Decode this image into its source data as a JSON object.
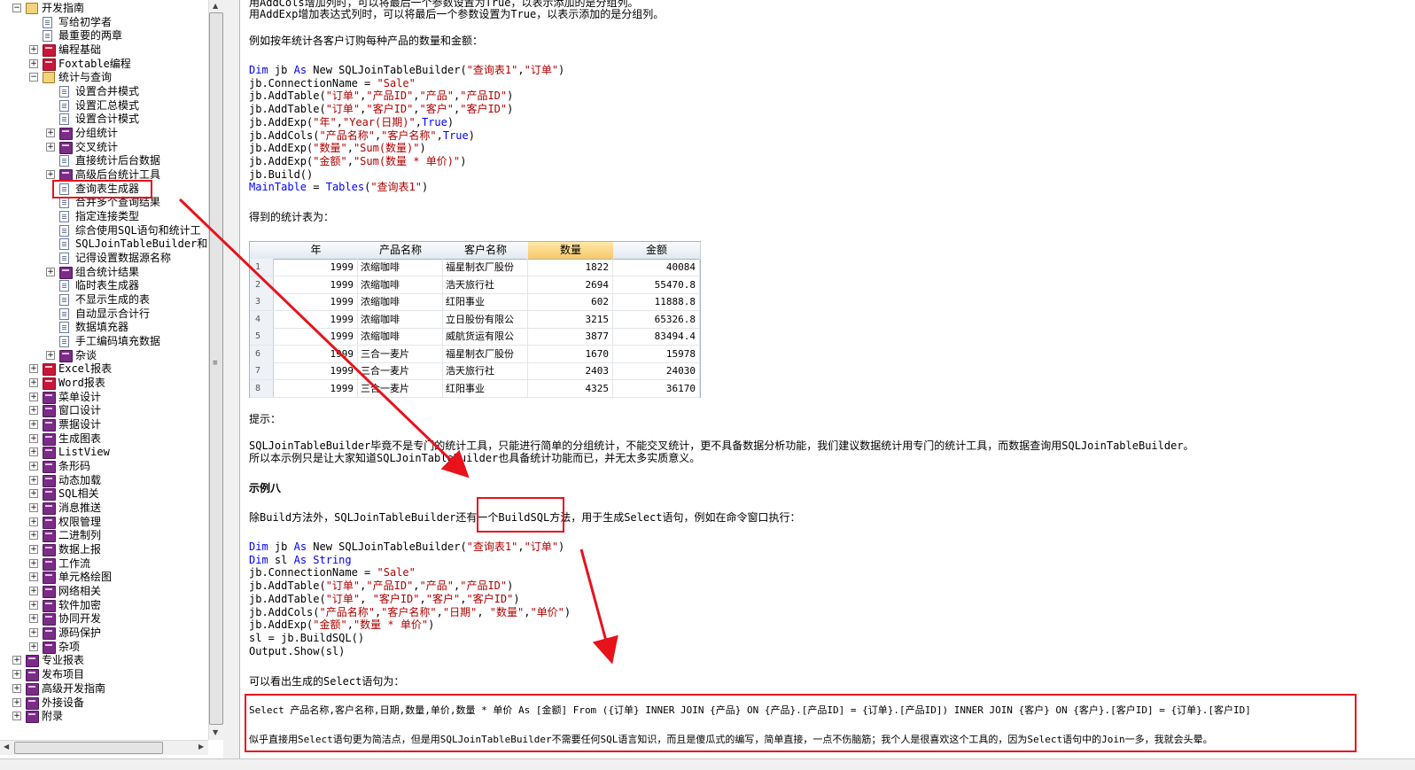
{
  "tree": {
    "items": [
      {
        "label": "开发指南",
        "level": 0,
        "icon": "book-open-icon",
        "expander": "minus"
      },
      {
        "label": "写给初学者",
        "level": 1,
        "icon": "page-icon",
        "expander": ""
      },
      {
        "label": "最重要的两章",
        "level": 1,
        "icon": "page-icon",
        "expander": ""
      },
      {
        "label": "编程基础",
        "level": 1,
        "icon": "book-red-icon",
        "expander": "plus"
      },
      {
        "label": "Foxtable编程",
        "level": 1,
        "icon": "book-red-icon",
        "expander": "plus"
      },
      {
        "label": "统计与查询",
        "level": 1,
        "icon": "book-open-icon",
        "expander": "minus"
      },
      {
        "label": "设置合并模式",
        "level": 2,
        "icon": "page-icon",
        "expander": ""
      },
      {
        "label": "设置汇总模式",
        "level": 2,
        "icon": "page-icon",
        "expander": ""
      },
      {
        "label": "设置合计模式",
        "level": 2,
        "icon": "page-icon",
        "expander": ""
      },
      {
        "label": "分组统计",
        "level": 2,
        "icon": "book-closed-icon",
        "expander": "plus"
      },
      {
        "label": "交叉统计",
        "level": 2,
        "icon": "book-closed-icon",
        "expander": "plus"
      },
      {
        "label": "直接统计后台数据",
        "level": 2,
        "icon": "page-icon",
        "expander": ""
      },
      {
        "label": "高级后台统计工具",
        "level": 2,
        "icon": "book-closed-icon",
        "expander": "plus"
      },
      {
        "label": "查询表生成器",
        "level": 2,
        "icon": "page-icon",
        "expander": "",
        "selected": true
      },
      {
        "label": "合并多个查询结果",
        "level": 2,
        "icon": "page-icon",
        "expander": ""
      },
      {
        "label": "指定连接类型",
        "level": 2,
        "icon": "page-icon",
        "expander": ""
      },
      {
        "label": "综合使用SQL语句和统计工",
        "level": 2,
        "icon": "page-icon",
        "expander": ""
      },
      {
        "label": "SQLJoinTableBuilder和纟",
        "level": 2,
        "icon": "page-icon",
        "expander": ""
      },
      {
        "label": "记得设置数据源名称",
        "level": 2,
        "icon": "page-icon",
        "expander": ""
      },
      {
        "label": "组合统计结果",
        "level": 2,
        "icon": "book-closed-icon",
        "expander": "plus"
      },
      {
        "label": "临时表生成器",
        "level": 2,
        "icon": "page-icon",
        "expander": ""
      },
      {
        "label": "不显示生成的表",
        "level": 2,
        "icon": "page-icon",
        "expander": ""
      },
      {
        "label": "自动显示合计行",
        "level": 2,
        "icon": "page-icon",
        "expander": ""
      },
      {
        "label": "数据填充器",
        "level": 2,
        "icon": "page-icon",
        "expander": ""
      },
      {
        "label": "手工编码填充数据",
        "level": 2,
        "icon": "page-icon",
        "expander": ""
      },
      {
        "label": "杂谈",
        "level": 2,
        "icon": "book-closed-icon",
        "expander": "plus"
      },
      {
        "label": "Excel报表",
        "level": 1,
        "icon": "book-red-icon",
        "expander": "plus"
      },
      {
        "label": "Word报表",
        "level": 1,
        "icon": "book-red-icon",
        "expander": "plus"
      },
      {
        "label": "菜单设计",
        "level": 1,
        "icon": "book-closed-icon",
        "expander": "plus"
      },
      {
        "label": "窗口设计",
        "level": 1,
        "icon": "book-closed-icon",
        "expander": "plus"
      },
      {
        "label": "票据设计",
        "level": 1,
        "icon": "book-closed-icon",
        "expander": "plus"
      },
      {
        "label": "生成图表",
        "level": 1,
        "icon": "book-closed-icon",
        "expander": "plus"
      },
      {
        "label": "ListView",
        "level": 1,
        "icon": "book-closed-icon",
        "expander": "plus"
      },
      {
        "label": "条形码",
        "level": 1,
        "icon": "book-closed-icon",
        "expander": "plus"
      },
      {
        "label": "动态加载",
        "level": 1,
        "icon": "book-closed-icon",
        "expander": "plus"
      },
      {
        "label": "SQL相关",
        "level": 1,
        "icon": "book-closed-icon",
        "expander": "plus"
      },
      {
        "label": "消息推送",
        "level": 1,
        "icon": "book-closed-icon",
        "expander": "plus"
      },
      {
        "label": "权限管理",
        "level": 1,
        "icon": "book-closed-icon",
        "expander": "plus"
      },
      {
        "label": "二进制列",
        "level": 1,
        "icon": "book-closed-icon",
        "expander": "plus"
      },
      {
        "label": "数据上报",
        "level": 1,
        "icon": "book-closed-icon",
        "expander": "plus"
      },
      {
        "label": "工作流",
        "level": 1,
        "icon": "book-closed-icon",
        "expander": "plus"
      },
      {
        "label": "单元格绘图",
        "level": 1,
        "icon": "book-closed-icon",
        "expander": "plus"
      },
      {
        "label": "网络相关",
        "level": 1,
        "icon": "book-closed-icon",
        "expander": "plus"
      },
      {
        "label": "软件加密",
        "level": 1,
        "icon": "book-closed-icon",
        "expander": "plus"
      },
      {
        "label": "协同开发",
        "level": 1,
        "icon": "book-closed-icon",
        "expander": "plus"
      },
      {
        "label": "源码保护",
        "level": 1,
        "icon": "book-closed-icon",
        "expander": "plus"
      },
      {
        "label": "杂项",
        "level": 1,
        "icon": "book-closed-icon",
        "expander": "plus"
      },
      {
        "label": "专业报表",
        "level": 0,
        "icon": "book-closed-icon",
        "expander": "plus"
      },
      {
        "label": "发布项目",
        "level": 0,
        "icon": "book-closed-icon",
        "expander": "plus"
      },
      {
        "label": "高级开发指南",
        "level": 0,
        "icon": "book-closed-icon",
        "expander": "plus"
      },
      {
        "label": "外接设备",
        "level": 0,
        "icon": "book-closed-icon",
        "expander": "plus"
      },
      {
        "label": "附录",
        "level": 0,
        "icon": "book-closed-icon",
        "expander": "plus"
      }
    ]
  },
  "doc": {
    "intro_line1": "用AddCols增加列时，可以将最后一个参数设置为True，以表示添加的是分组列。",
    "intro_line2": "用AddExp增加表达式列时，可以将最后一个参数设置为True，以表示添加的是分组列。",
    "example_intro": "例如按年统计各客户订购每种产品的数量和金额：",
    "code1": [
      [
        {
          "t": "Dim ",
          "c": "kw"
        },
        {
          "t": "jb ",
          "c": ""
        },
        {
          "t": "As ",
          "c": "kw"
        },
        {
          "t": "New SQLJoinTableBuilder(",
          "c": ""
        },
        {
          "t": "\"查询表1\"",
          "c": "st"
        },
        {
          "t": ",",
          "c": ""
        },
        {
          "t": "\"订单\"",
          "c": "st"
        },
        {
          "t": ")",
          "c": ""
        }
      ],
      [
        {
          "t": "jb.ConnectionName = ",
          "c": ""
        },
        {
          "t": "\"Sale\"",
          "c": "st"
        }
      ],
      [
        {
          "t": "jb.AddTable(",
          "c": ""
        },
        {
          "t": "\"订单\"",
          "c": "st"
        },
        {
          "t": ",",
          "c": ""
        },
        {
          "t": "\"产品ID\"",
          "c": "st"
        },
        {
          "t": ",",
          "c": ""
        },
        {
          "t": "\"产品\"",
          "c": "st"
        },
        {
          "t": ",",
          "c": ""
        },
        {
          "t": "\"产品ID\"",
          "c": "st"
        },
        {
          "t": ")",
          "c": ""
        }
      ],
      [
        {
          "t": "jb.AddTable(",
          "c": ""
        },
        {
          "t": "\"订单\"",
          "c": "st"
        },
        {
          "t": ",",
          "c": ""
        },
        {
          "t": "\"客户ID\"",
          "c": "st"
        },
        {
          "t": ",",
          "c": ""
        },
        {
          "t": "\"客户\"",
          "c": "st"
        },
        {
          "t": ",",
          "c": ""
        },
        {
          "t": "\"客户ID\"",
          "c": "st"
        },
        {
          "t": ")",
          "c": ""
        }
      ],
      [
        {
          "t": "jb.AddExp(",
          "c": ""
        },
        {
          "t": "\"年\"",
          "c": "st"
        },
        {
          "t": ",",
          "c": ""
        },
        {
          "t": "\"Year(日期)\"",
          "c": "st"
        },
        {
          "t": ",",
          "c": ""
        },
        {
          "t": "True",
          "c": "kw"
        },
        {
          "t": ")",
          "c": ""
        }
      ],
      [
        {
          "t": "jb.AddCols(",
          "c": ""
        },
        {
          "t": "\"产品名称\"",
          "c": "st"
        },
        {
          "t": ",",
          "c": ""
        },
        {
          "t": "\"客户名称\"",
          "c": "st"
        },
        {
          "t": ",",
          "c": ""
        },
        {
          "t": "True",
          "c": "kw"
        },
        {
          "t": ")",
          "c": ""
        }
      ],
      [
        {
          "t": "jb.AddExp(",
          "c": ""
        },
        {
          "t": "\"数量\"",
          "c": "st"
        },
        {
          "t": ",",
          "c": ""
        },
        {
          "t": "\"Sum(数量)\"",
          "c": "st"
        },
        {
          "t": ")",
          "c": ""
        }
      ],
      [
        {
          "t": "jb.AddExp(",
          "c": ""
        },
        {
          "t": "\"金额\"",
          "c": "st"
        },
        {
          "t": ",",
          "c": ""
        },
        {
          "t": "\"Sum(数量 * 单价)\"",
          "c": "st"
        },
        {
          "t": ")",
          "c": ""
        }
      ],
      [
        {
          "t": "jb.Build()",
          "c": ""
        }
      ],
      [
        {
          "t": "MainTable",
          "c": "kw"
        },
        {
          "t": " = ",
          "c": ""
        },
        {
          "t": "Tables",
          "c": "kw"
        },
        {
          "t": "(",
          "c": ""
        },
        {
          "t": "\"查询表1\"",
          "c": "st"
        },
        {
          "t": ")",
          "c": ""
        }
      ]
    ],
    "result_label": "得到的统计表为：",
    "grid": {
      "headers": [
        "年",
        "产品名称",
        "客户名称",
        "数量",
        "金额"
      ],
      "selected_header": 3,
      "rows": [
        [
          "1",
          "1999",
          "浓缩咖啡",
          "福星制衣厂股份",
          "1822",
          "40084"
        ],
        [
          "2",
          "1999",
          "浓缩咖啡",
          "浩天旅行社",
          "2694",
          "55470.8"
        ],
        [
          "3",
          "1999",
          "浓缩咖啡",
          "红阳事业",
          "602",
          "11888.8"
        ],
        [
          "4",
          "1999",
          "浓缩咖啡",
          "立日股份有限公",
          "3215",
          "65326.8"
        ],
        [
          "5",
          "1999",
          "浓缩咖啡",
          "威航货运有限公",
          "3877",
          "83494.4"
        ],
        [
          "6",
          "1999",
          "三合一麦片",
          "福星制衣厂股份",
          "1670",
          "15978"
        ],
        [
          "7",
          "1999",
          "三合一麦片",
          "浩天旅行社",
          "2403",
          "24030"
        ],
        [
          "8",
          "1999",
          "三合一麦片",
          "红阳事业",
          "4325",
          "36170"
        ]
      ]
    },
    "tip_label": "提示：",
    "tip_line1": "SQLJoinTableBuilder毕竟不是专门的统计工具，只能进行简单的分组统计，不能交叉统计，更不具备数据分析功能，我们建议数据统计用专门的统计工具，而数据查询用SQLJoinTableBuilder。",
    "tip_line2": "所以本示例只是让大家知道SQLJoinTableBuilder也具备统计功能而已，并无太多实质意义。",
    "example8_title": "示例八",
    "example8_desc": "除Build方法外，SQLJoinTableBuilder还有一个BuildSQL方法，用于生成Select语句，例如在命令窗口执行：",
    "code2": [
      [
        {
          "t": "Dim ",
          "c": "kw"
        },
        {
          "t": "jb ",
          "c": ""
        },
        {
          "t": "As ",
          "c": "kw"
        },
        {
          "t": "New SQLJoinTableBuilder(",
          "c": ""
        },
        {
          "t": "\"查询表1\"",
          "c": "st"
        },
        {
          "t": ",",
          "c": ""
        },
        {
          "t": "\"订单\"",
          "c": "st"
        },
        {
          "t": ")",
          "c": ""
        }
      ],
      [
        {
          "t": "Dim ",
          "c": "kw"
        },
        {
          "t": "sl ",
          "c": ""
        },
        {
          "t": "As ",
          "c": "kw"
        },
        {
          "t": "String",
          "c": "mt"
        }
      ],
      [
        {
          "t": "jb.ConnectionName = ",
          "c": ""
        },
        {
          "t": "\"Sale\"",
          "c": "st"
        }
      ],
      [
        {
          "t": "jb.AddTable(",
          "c": ""
        },
        {
          "t": "\"订单\"",
          "c": "st"
        },
        {
          "t": ",",
          "c": ""
        },
        {
          "t": "\"产品ID\"",
          "c": "st"
        },
        {
          "t": ",",
          "c": ""
        },
        {
          "t": "\"产品\"",
          "c": "st"
        },
        {
          "t": ",",
          "c": ""
        },
        {
          "t": "\"产品ID\"",
          "c": "st"
        },
        {
          "t": ")",
          "c": ""
        }
      ],
      [
        {
          "t": "jb.AddTable(",
          "c": ""
        },
        {
          "t": "\"订单\"",
          "c": "st"
        },
        {
          "t": ", ",
          "c": ""
        },
        {
          "t": "\"客户ID\"",
          "c": "st"
        },
        {
          "t": ",",
          "c": ""
        },
        {
          "t": "\"客户\"",
          "c": "st"
        },
        {
          "t": ",",
          "c": ""
        },
        {
          "t": "\"客户ID\"",
          "c": "st"
        },
        {
          "t": ")",
          "c": ""
        }
      ],
      [
        {
          "t": "jb.AddCols(",
          "c": ""
        },
        {
          "t": "\"产品名称\"",
          "c": "st"
        },
        {
          "t": ",",
          "c": ""
        },
        {
          "t": "\"客户名称\"",
          "c": "st"
        },
        {
          "t": ",",
          "c": ""
        },
        {
          "t": "\"日期\"",
          "c": "st"
        },
        {
          "t": ", ",
          "c": ""
        },
        {
          "t": "\"数量\"",
          "c": "st"
        },
        {
          "t": ",",
          "c": ""
        },
        {
          "t": "\"单价\"",
          "c": "st"
        },
        {
          "t": ")",
          "c": ""
        }
      ],
      [
        {
          "t": "jb.AddExp(",
          "c": ""
        },
        {
          "t": "\"金额\"",
          "c": "st"
        },
        {
          "t": ",",
          "c": ""
        },
        {
          "t": "\"数量 * 单价\"",
          "c": "st"
        },
        {
          "t": ")",
          "c": ""
        }
      ],
      [
        {
          "t": "sl = jb.BuildSQL()",
          "c": ""
        }
      ],
      [
        {
          "t": "Output.Show(sl)",
          "c": ""
        }
      ]
    ],
    "select_label": "可以看出生成的Select语句为：",
    "select_sql": "Select 产品名称,客户名称,日期,数量,单价,数量 * 单价 As [金额] From ({订单} INNER JOIN {产品} ON {产品}.[产品ID] = {订单}.[产品ID]) INNER JOIN {客户} ON {客户}.[客户ID] = {订单}.[客户ID]",
    "closing": "似乎直接用Select语句更为简洁点，但是用SQLJoinTableBuilder不需要任何SQL语言知识，而且是傻瓜式的编写，简单直接，一点不伤脑筋；我个人是很喜欢这个工具的，因为Select语句中的Join一多，我就会头晕。"
  },
  "colors": {
    "annotation_red": "#e8121b",
    "keyword_blue": "#0000ff",
    "string_red": "#b00000"
  }
}
